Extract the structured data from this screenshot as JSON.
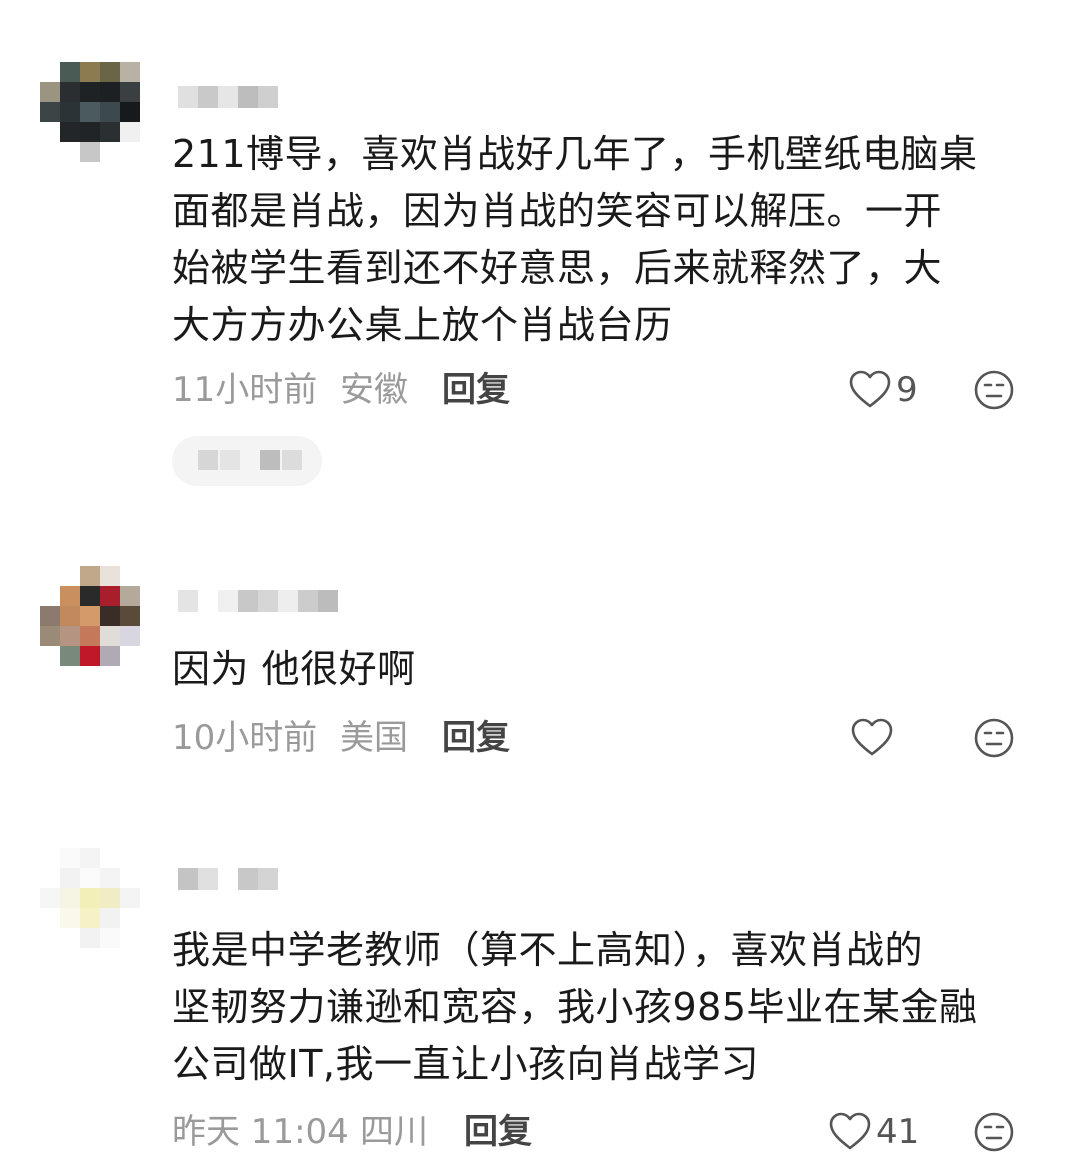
{
  "comments": [
    {
      "text": "211博导，喜欢肖战好几年了，手机壁纸电脑桌\n面都是肖战，因为肖战的笑容可以解压。一开\n始被学生看到还不好意思，后来就释然了，大\n大方方办公桌上放个肖战台历",
      "time": "11小时前",
      "location": "安徽",
      "reply_label": "回复",
      "like_count": "9"
    },
    {
      "text": "因为 他很好啊",
      "time": "10小时前",
      "location": "美国",
      "reply_label": "回复",
      "like_count": ""
    },
    {
      "text": "我是中学老教师（算不上高知），喜欢肖战的\n坚韧努力谦逊和宽容，我小孩985毕业在某金融\n公司做IT,我一直让小孩向肖战学习",
      "time": "昨天 11:04",
      "location": "四川",
      "reply_label": "回复",
      "like_count": "41"
    }
  ],
  "icons": {
    "like": "heart-outline-icon",
    "dislike": "face-neutral-icon"
  },
  "colors": {
    "text": "#1a1a1a",
    "meta": "#9a9a9a",
    "reply": "#444444",
    "icon": "#555555"
  }
}
